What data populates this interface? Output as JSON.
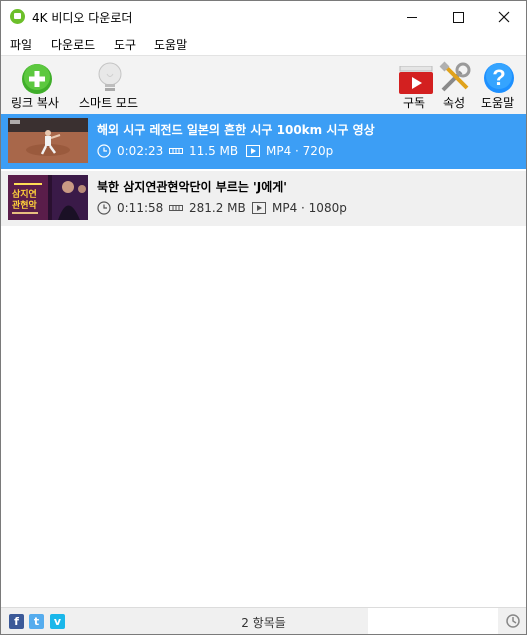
{
  "window": {
    "title": "4K 비디오 다운로더"
  },
  "menu": [
    "파일",
    "다운로드",
    "도구",
    "도움말"
  ],
  "toolbar": {
    "paste_link": "링크 복사",
    "smart_mode": "스마트 모드",
    "subscriptions": "구독",
    "preferences": "속성",
    "help": "도움말"
  },
  "downloads": [
    {
      "title": "해외 시구 레전드 일본의 흔한 시구 100km 시구 영상",
      "duration": "0:02:23",
      "size": "11.5 MB",
      "format": "MP4 · 720p",
      "selected": true
    },
    {
      "title": "북한 삼지연관현악단이 부르는 'J에게'",
      "duration": "0:11:58",
      "size": "281.2 MB",
      "format": "MP4 · 1080p",
      "selected": false
    }
  ],
  "thumb2_text": "삼지연\n관현악",
  "status": {
    "count": "2 항목들"
  },
  "colors": {
    "selected_row": "#3c9ef5",
    "accent_green": "#3fae2a",
    "help_blue": "#1e90ff",
    "youtube_red": "#d32020"
  }
}
